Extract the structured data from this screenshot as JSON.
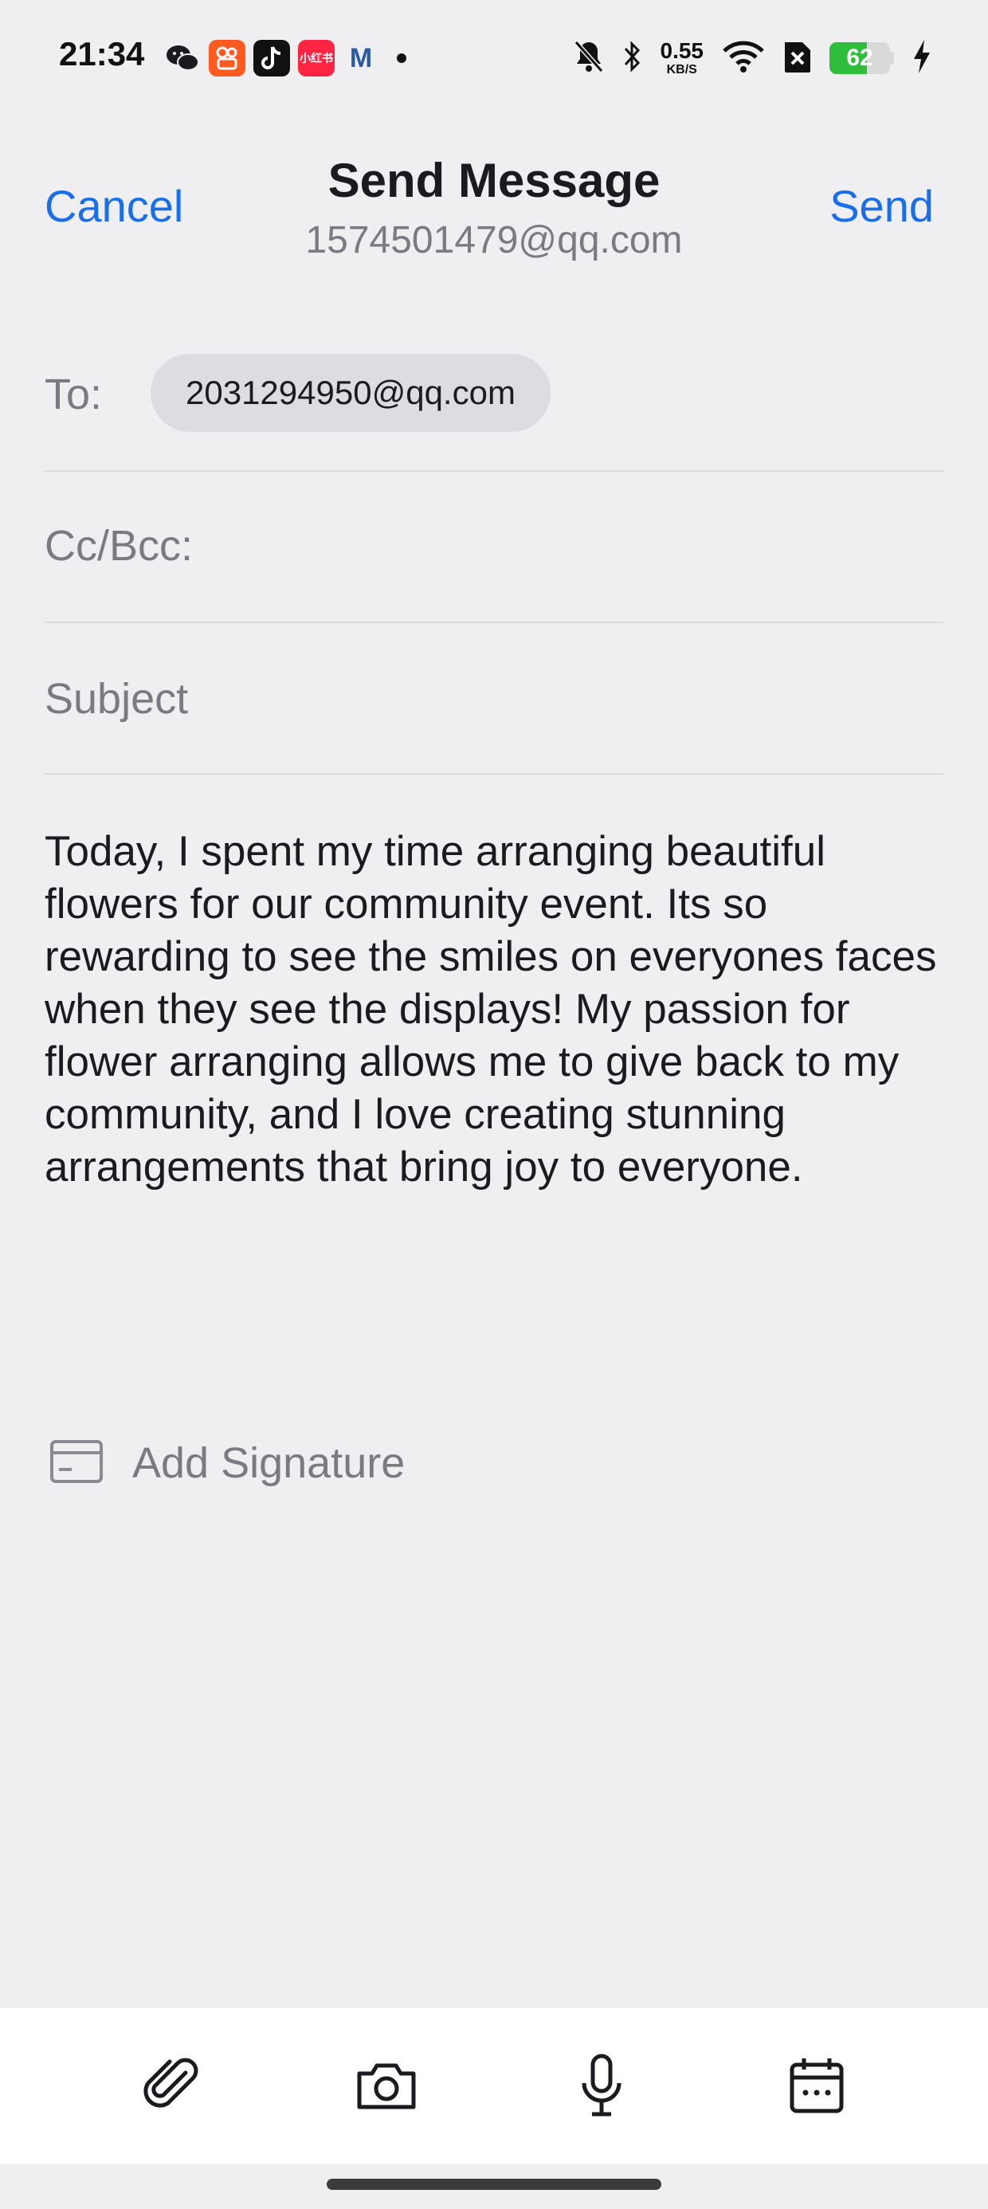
{
  "status_bar": {
    "time": "21:34",
    "app_icons": [
      {
        "name": "wechat-icon",
        "color": "#1b1b1f"
      },
      {
        "name": "kuaishou-icon",
        "color": "#ff5a1f"
      },
      {
        "name": "tiktok-icon",
        "color": "#111111"
      },
      {
        "name": "xiaohongshu-icon",
        "color": "#ff2442",
        "label": "小红书"
      },
      {
        "name": "gmail-m-icon",
        "color": "#2c5aa0",
        "label": "M"
      }
    ],
    "net_speed_value": "0.55",
    "net_speed_unit": "KB/S",
    "battery_percent": "62",
    "battery_level": 62
  },
  "header": {
    "cancel_label": "Cancel",
    "title": "Send Message",
    "account": "1574501479@qq.com",
    "send_label": "Send",
    "accent_color": "#1a6fe8"
  },
  "fields": {
    "to_label": "To:",
    "to_recipient": "2031294950@qq.com",
    "cc_label": "Cc/Bcc:",
    "cc_value": "",
    "subject_placeholder": "Subject",
    "subject_value": ""
  },
  "body": {
    "text": "Today, I spent my time arranging beautiful flowers for our community event. Its so rewarding to see the smiles on everyones faces when they see the displays! My passion for flower arranging allows me to give back to my community, and I love creating stunning arrangements that bring joy to everyone."
  },
  "signature": {
    "label": "Add Signature",
    "icon": "signature-card-icon"
  },
  "toolbar": {
    "buttons": [
      {
        "icon": "attachment-icon"
      },
      {
        "icon": "camera-icon"
      },
      {
        "icon": "microphone-icon"
      },
      {
        "icon": "calendar-icon"
      }
    ]
  }
}
